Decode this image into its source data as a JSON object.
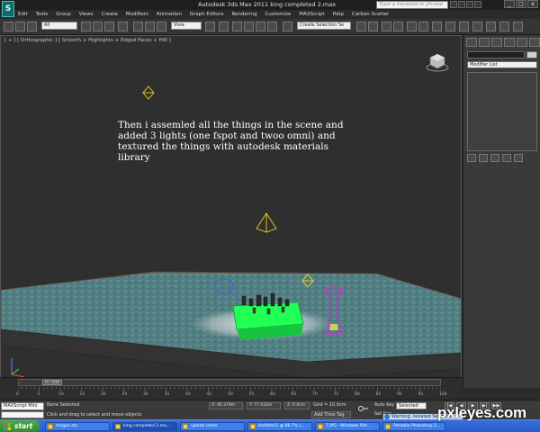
{
  "window": {
    "logo_letter": "S",
    "title": "Autodesk 3ds Max  2011      king completed   2.max",
    "search_placeholder": "Type a keyword or phrase",
    "controls": [
      "_",
      "□",
      "x"
    ]
  },
  "menu": {
    "items": [
      "Edit",
      "Tools",
      "Group",
      "Views",
      "Create",
      "Modifiers",
      "Animation",
      "Graph Editors",
      "Rendering",
      "Customize",
      "MAXScript",
      "Help",
      "Carbon Scatter"
    ]
  },
  "toolbar": {
    "filter_value": "All",
    "refcoord_value": "View",
    "selection_set_value": "Create Selection Se"
  },
  "command_panel": {
    "modifier_list": "Modifier List"
  },
  "viewport": {
    "label": "[ + ] [ Orthographic ] [ Smooth + Highlights + Edged Faces + HW ]",
    "note": "Then i assemled all the things in the scene and\nadded 3 lights (one fspot and twoo omni) and\ntextured the things with autodesk materials\nlibrary",
    "colors": {
      "floor": "#4f7a7e",
      "floor_edge": "#3a3a3a",
      "table_rim": "#8a4a3a",
      "chessboard": "#22ff55",
      "light_gizmo": "#f2d218",
      "hourglass": "#cc33cc",
      "spot_ring": "#3a6ad0"
    }
  },
  "timeline": {
    "thumb": "0 / 100",
    "ticks": [
      "0",
      "5",
      "10",
      "15",
      "20",
      "25",
      "30",
      "35",
      "40",
      "45",
      "50",
      "55",
      "60",
      "65",
      "70",
      "75",
      "80",
      "85",
      "90",
      "95",
      "100"
    ]
  },
  "status": {
    "maxscript": "MAXScript Mini",
    "selection": "None Selected",
    "prompt": "Click and drag to select and move objects",
    "x": "X: 46.379m",
    "y": "Y: 77.432m",
    "z": "Z: 0.0cm",
    "grid": "Grid = 10.0cm",
    "add_time_tag": "Add Time Tag",
    "auto_key": "Auto Key",
    "auto_key_value": "Selected",
    "set_key": "Set Key",
    "warning": "Warning: Isolated Selection"
  },
  "taskbar": {
    "start": "start",
    "items": [
      "dragon.stx",
      "king completed   2.ma...",
      "upload chess",
      "Untitled-1 @ 66.7% (...",
      "7.JPG - Windows Pict...",
      "Portable Photoshop 2..."
    ]
  },
  "watermark": "pxleyes.com"
}
